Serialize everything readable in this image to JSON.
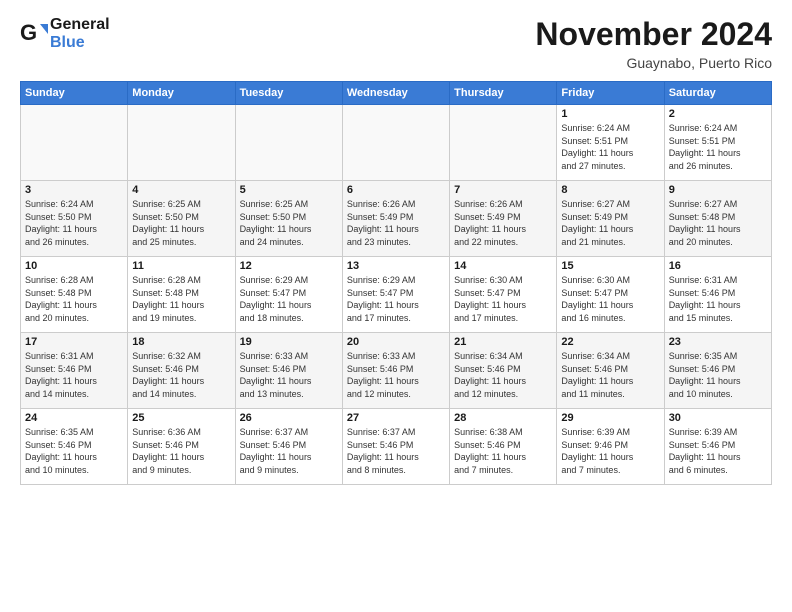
{
  "header": {
    "logo_line1": "General",
    "logo_line2": "Blue",
    "month_title": "November 2024",
    "subtitle": "Guaynabo, Puerto Rico"
  },
  "weekdays": [
    "Sunday",
    "Monday",
    "Tuesday",
    "Wednesday",
    "Thursday",
    "Friday",
    "Saturday"
  ],
  "weeks": [
    [
      {
        "day": "",
        "info": ""
      },
      {
        "day": "",
        "info": ""
      },
      {
        "day": "",
        "info": ""
      },
      {
        "day": "",
        "info": ""
      },
      {
        "day": "",
        "info": ""
      },
      {
        "day": "1",
        "info": "Sunrise: 6:24 AM\nSunset: 5:51 PM\nDaylight: 11 hours\nand 27 minutes."
      },
      {
        "day": "2",
        "info": "Sunrise: 6:24 AM\nSunset: 5:51 PM\nDaylight: 11 hours\nand 26 minutes."
      }
    ],
    [
      {
        "day": "3",
        "info": "Sunrise: 6:24 AM\nSunset: 5:50 PM\nDaylight: 11 hours\nand 26 minutes."
      },
      {
        "day": "4",
        "info": "Sunrise: 6:25 AM\nSunset: 5:50 PM\nDaylight: 11 hours\nand 25 minutes."
      },
      {
        "day": "5",
        "info": "Sunrise: 6:25 AM\nSunset: 5:50 PM\nDaylight: 11 hours\nand 24 minutes."
      },
      {
        "day": "6",
        "info": "Sunrise: 6:26 AM\nSunset: 5:49 PM\nDaylight: 11 hours\nand 23 minutes."
      },
      {
        "day": "7",
        "info": "Sunrise: 6:26 AM\nSunset: 5:49 PM\nDaylight: 11 hours\nand 22 minutes."
      },
      {
        "day": "8",
        "info": "Sunrise: 6:27 AM\nSunset: 5:49 PM\nDaylight: 11 hours\nand 21 minutes."
      },
      {
        "day": "9",
        "info": "Sunrise: 6:27 AM\nSunset: 5:48 PM\nDaylight: 11 hours\nand 20 minutes."
      }
    ],
    [
      {
        "day": "10",
        "info": "Sunrise: 6:28 AM\nSunset: 5:48 PM\nDaylight: 11 hours\nand 20 minutes."
      },
      {
        "day": "11",
        "info": "Sunrise: 6:28 AM\nSunset: 5:48 PM\nDaylight: 11 hours\nand 19 minutes."
      },
      {
        "day": "12",
        "info": "Sunrise: 6:29 AM\nSunset: 5:47 PM\nDaylight: 11 hours\nand 18 minutes."
      },
      {
        "day": "13",
        "info": "Sunrise: 6:29 AM\nSunset: 5:47 PM\nDaylight: 11 hours\nand 17 minutes."
      },
      {
        "day": "14",
        "info": "Sunrise: 6:30 AM\nSunset: 5:47 PM\nDaylight: 11 hours\nand 17 minutes."
      },
      {
        "day": "15",
        "info": "Sunrise: 6:30 AM\nSunset: 5:47 PM\nDaylight: 11 hours\nand 16 minutes."
      },
      {
        "day": "16",
        "info": "Sunrise: 6:31 AM\nSunset: 5:46 PM\nDaylight: 11 hours\nand 15 minutes."
      }
    ],
    [
      {
        "day": "17",
        "info": "Sunrise: 6:31 AM\nSunset: 5:46 PM\nDaylight: 11 hours\nand 14 minutes."
      },
      {
        "day": "18",
        "info": "Sunrise: 6:32 AM\nSunset: 5:46 PM\nDaylight: 11 hours\nand 14 minutes."
      },
      {
        "day": "19",
        "info": "Sunrise: 6:33 AM\nSunset: 5:46 PM\nDaylight: 11 hours\nand 13 minutes."
      },
      {
        "day": "20",
        "info": "Sunrise: 6:33 AM\nSunset: 5:46 PM\nDaylight: 11 hours\nand 12 minutes."
      },
      {
        "day": "21",
        "info": "Sunrise: 6:34 AM\nSunset: 5:46 PM\nDaylight: 11 hours\nand 12 minutes."
      },
      {
        "day": "22",
        "info": "Sunrise: 6:34 AM\nSunset: 5:46 PM\nDaylight: 11 hours\nand 11 minutes."
      },
      {
        "day": "23",
        "info": "Sunrise: 6:35 AM\nSunset: 5:46 PM\nDaylight: 11 hours\nand 10 minutes."
      }
    ],
    [
      {
        "day": "24",
        "info": "Sunrise: 6:35 AM\nSunset: 5:46 PM\nDaylight: 11 hours\nand 10 minutes."
      },
      {
        "day": "25",
        "info": "Sunrise: 6:36 AM\nSunset: 5:46 PM\nDaylight: 11 hours\nand 9 minutes."
      },
      {
        "day": "26",
        "info": "Sunrise: 6:37 AM\nSunset: 5:46 PM\nDaylight: 11 hours\nand 9 minutes."
      },
      {
        "day": "27",
        "info": "Sunrise: 6:37 AM\nSunset: 5:46 PM\nDaylight: 11 hours\nand 8 minutes."
      },
      {
        "day": "28",
        "info": "Sunrise: 6:38 AM\nSunset: 5:46 PM\nDaylight: 11 hours\nand 7 minutes."
      },
      {
        "day": "29",
        "info": "Sunrise: 6:39 AM\nSunset: 9:46 PM\nDaylight: 11 hours\nand 7 minutes."
      },
      {
        "day": "30",
        "info": "Sunrise: 6:39 AM\nSunset: 5:46 PM\nDaylight: 11 hours\nand 6 minutes."
      }
    ]
  ]
}
